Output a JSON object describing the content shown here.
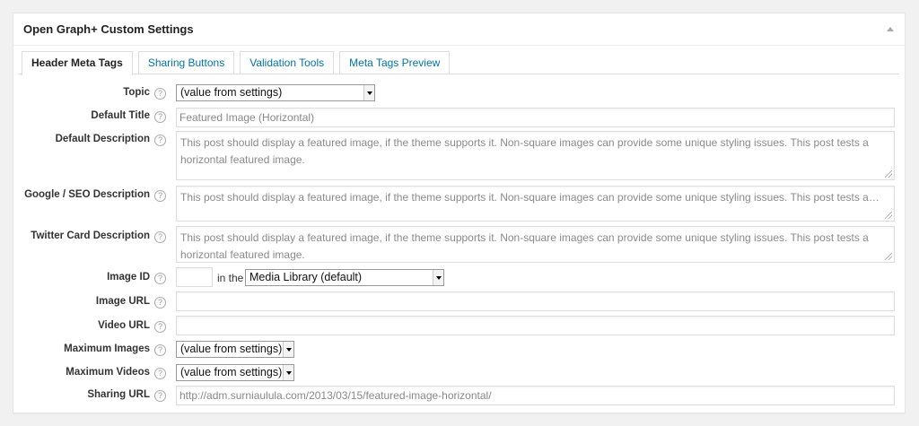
{
  "postbox": {
    "title": "Open Graph+ Custom Settings"
  },
  "tabs": [
    {
      "label": "Header Meta Tags",
      "active": true
    },
    {
      "label": "Sharing Buttons",
      "active": false
    },
    {
      "label": "Validation Tools",
      "active": false
    },
    {
      "label": "Meta Tags Preview",
      "active": false
    }
  ],
  "help_glyph": "?",
  "fields": {
    "topic": {
      "label": "Topic",
      "value": "(value from settings)"
    },
    "default_title": {
      "label": "Default Title",
      "placeholder": "Featured Image (Horizontal)"
    },
    "default_description": {
      "label": "Default Description",
      "placeholder": "This post should display a featured image, if the theme supports it. Non-square images can provide some unique styling issues. This post tests a horizontal featured image."
    },
    "google_description": {
      "label": "Google / SEO Description",
      "placeholder": "This post should display a featured image, if the theme supports it. Non-square images can provide some unique styling issues. This post tests a…"
    },
    "twitter_description": {
      "label": "Twitter Card Description",
      "placeholder": "This post should display a featured image, if the theme supports it. Non-square images can provide some unique styling issues. This post tests a horizontal featured image."
    },
    "image_id": {
      "label": "Image ID",
      "value": "",
      "in_the": "in the",
      "library_value": "Media Library (default)"
    },
    "image_url": {
      "label": "Image URL",
      "value": ""
    },
    "video_url": {
      "label": "Video URL",
      "value": ""
    },
    "max_images": {
      "label": "Maximum Images",
      "value": "(value from settings)"
    },
    "max_videos": {
      "label": "Maximum Videos",
      "value": "(value from settings)"
    },
    "sharing_url": {
      "label": "Sharing URL",
      "placeholder": "http://adm.surniaulula.com/2013/03/15/featured-image-horizontal/"
    }
  }
}
